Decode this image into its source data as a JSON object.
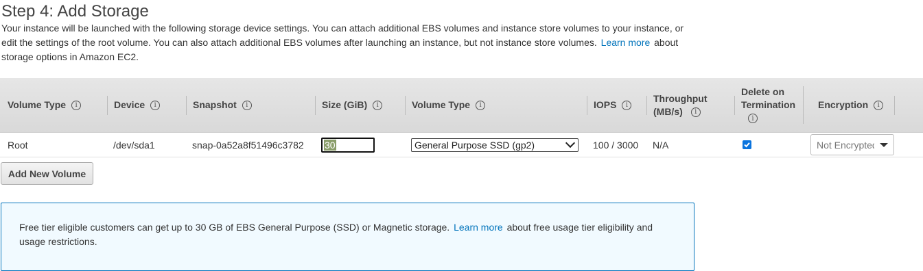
{
  "page": {
    "title": "Step 4: Add Storage",
    "description_part1": "Your instance will be launched with the following storage device settings. You can attach additional EBS volumes and instance store volumes to your instance, or edit the settings of the root volume. You can also attach additional EBS volumes after launching an instance, but not instance store volumes.",
    "learn_more_label": "Learn more",
    "description_part2": "about storage options in Amazon EC2."
  },
  "table": {
    "headers": {
      "volume_type": "Volume Type",
      "device": "Device",
      "snapshot": "Snapshot",
      "size": "Size (GiB)",
      "volume_type2": "Volume Type",
      "iops": "IOPS",
      "throughput_line1": "Throughput",
      "throughput_line2": "(MB/s)",
      "delete_line1": "Delete on",
      "delete_line2": "Termination",
      "encryption": "Encryption"
    },
    "info_icon_glyph": "i",
    "row": {
      "volume_type": "Root",
      "device": "/dev/sda1",
      "snapshot": "snap-0a52a8f51496c3782",
      "size": "30",
      "ebs_volume_type": "General Purpose SSD (gp2)",
      "iops": "100 / 3000",
      "throughput": "N/A",
      "delete_on_termination": true,
      "encryption": "Not Encrypted"
    }
  },
  "buttons": {
    "add_new_volume": "Add New Volume"
  },
  "free_tier": {
    "text_part1": "Free tier eligible customers can get up to 30 GB of EBS General Purpose (SSD) or Magnetic storage.",
    "learn_more_label": "Learn more",
    "text_part2": "about free usage tier eligibility and usage restrictions."
  },
  "colors": {
    "link": "#0073bb",
    "header_bg": "#dcdcdc",
    "checkbox": "#0b74de",
    "info_border": "#0073bb"
  }
}
